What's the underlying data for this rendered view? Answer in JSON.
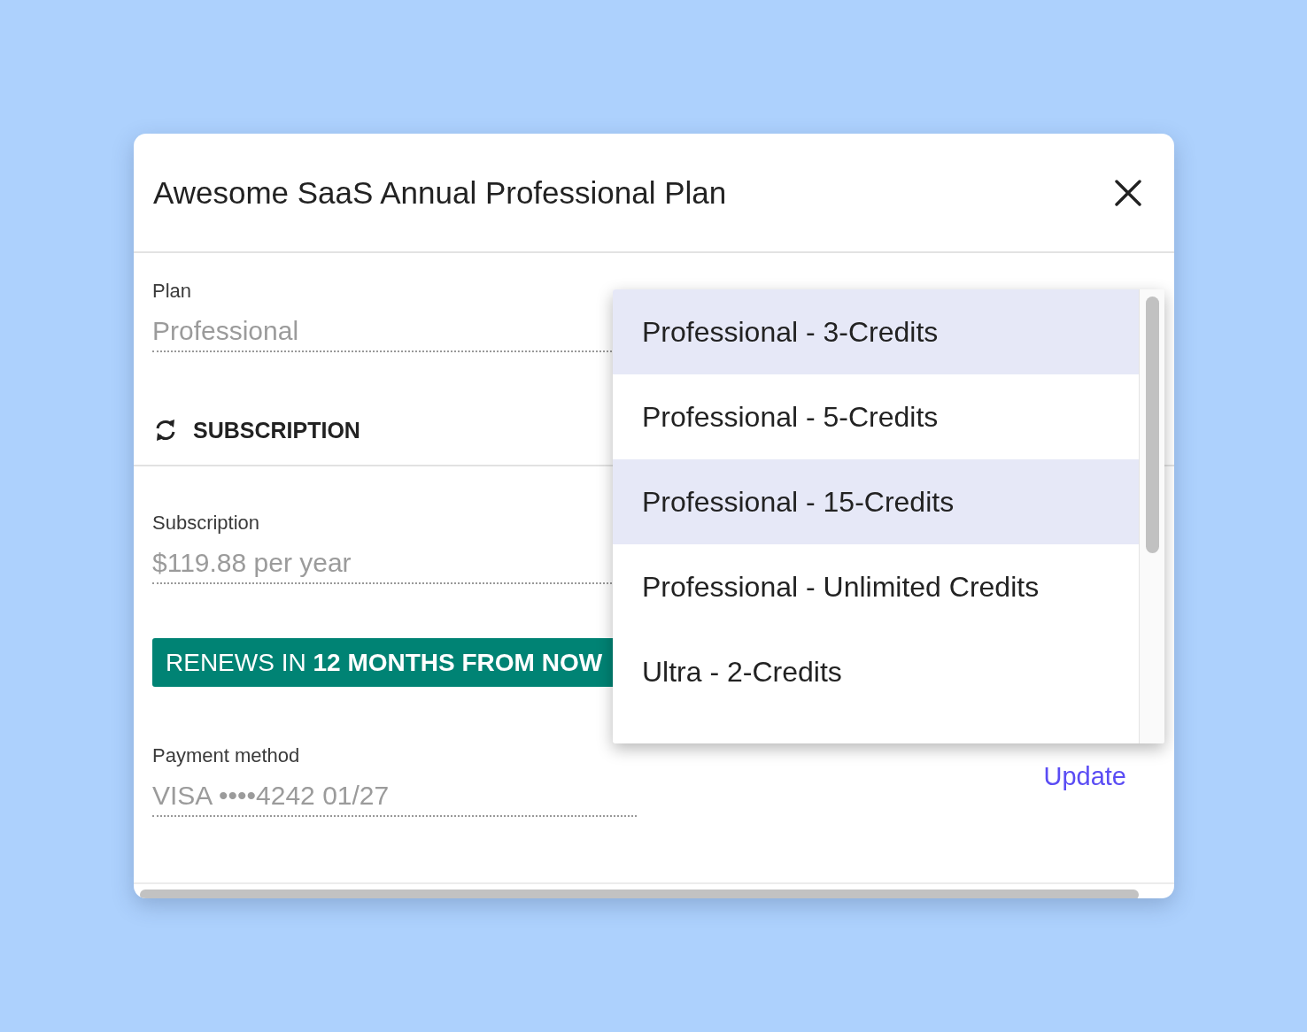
{
  "dialog": {
    "title": "Awesome SaaS Annual Professional Plan"
  },
  "plan": {
    "label": "Plan",
    "value": "Professional"
  },
  "section": {
    "title": "SUBSCRIPTION"
  },
  "subscription": {
    "label": "Subscription",
    "value": "$119.88 per year"
  },
  "renewal_badge": "RENEWS IN **12 MONTHS FROM NOW**",
  "payment": {
    "label": "Payment method",
    "value": "VISA ••••4242 01/27",
    "action": "Update"
  },
  "plan_dropdown": {
    "options": [
      {
        "label": "Professional - 3-Credits",
        "selected": true
      },
      {
        "label": "Professional - 5-Credits",
        "selected": false
      },
      {
        "label": "Professional - 15-Credits",
        "selected": true
      },
      {
        "label": "Professional - Unlimited Credits",
        "selected": false
      },
      {
        "label": "Ultra - 2-Credits",
        "selected": false
      }
    ]
  }
}
